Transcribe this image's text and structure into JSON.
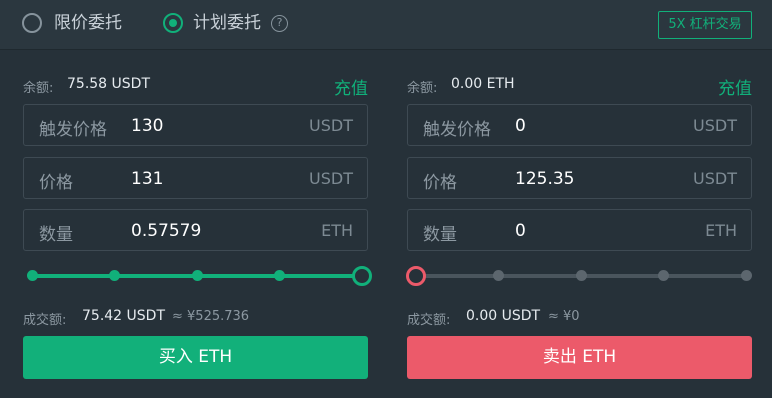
{
  "order_types": {
    "limit_label": "限价委托",
    "plan_label": "计划委托",
    "selected": "plan"
  },
  "help_glyph": "?",
  "leverage_label": "5X 杠杆交易",
  "buy": {
    "balance_label": "余额:",
    "balance_value": "75.58 USDT",
    "deposit_label": "充值",
    "trigger_label": "触发价格",
    "trigger_value": "130",
    "trigger_unit": "USDT",
    "price_label": "价格",
    "price_value": "131",
    "price_unit": "USDT",
    "amount_label": "数量",
    "amount_value": "0.57579",
    "amount_unit": "ETH",
    "slider_fraction": 1.0,
    "trade_label": "成交额:",
    "trade_value": "75.42 USDT",
    "trade_approx": "≈ ¥525.736",
    "button_label": "买入 ETH"
  },
  "sell": {
    "balance_label": "余额:",
    "balance_value": "0.00 ETH",
    "deposit_label": "充值",
    "trigger_label": "触发价格",
    "trigger_value": "0",
    "trigger_unit": "USDT",
    "price_label": "价格",
    "price_value": "125.35",
    "price_unit": "USDT",
    "amount_label": "数量",
    "amount_value": "0",
    "amount_unit": "ETH",
    "slider_fraction": 0.0,
    "trade_label": "成交额:",
    "trade_value": "0.00 USDT",
    "trade_approx": "≈ ¥0",
    "button_label": "卖出 ETH"
  },
  "colors": {
    "background": "#263139",
    "buy_accent": "#12b07a",
    "sell_accent": "#ec5a6a"
  },
  "icons": {
    "radio_unselected": "radio-unselected-icon",
    "radio_selected": "radio-selected-icon",
    "help": "question-circle-icon"
  }
}
